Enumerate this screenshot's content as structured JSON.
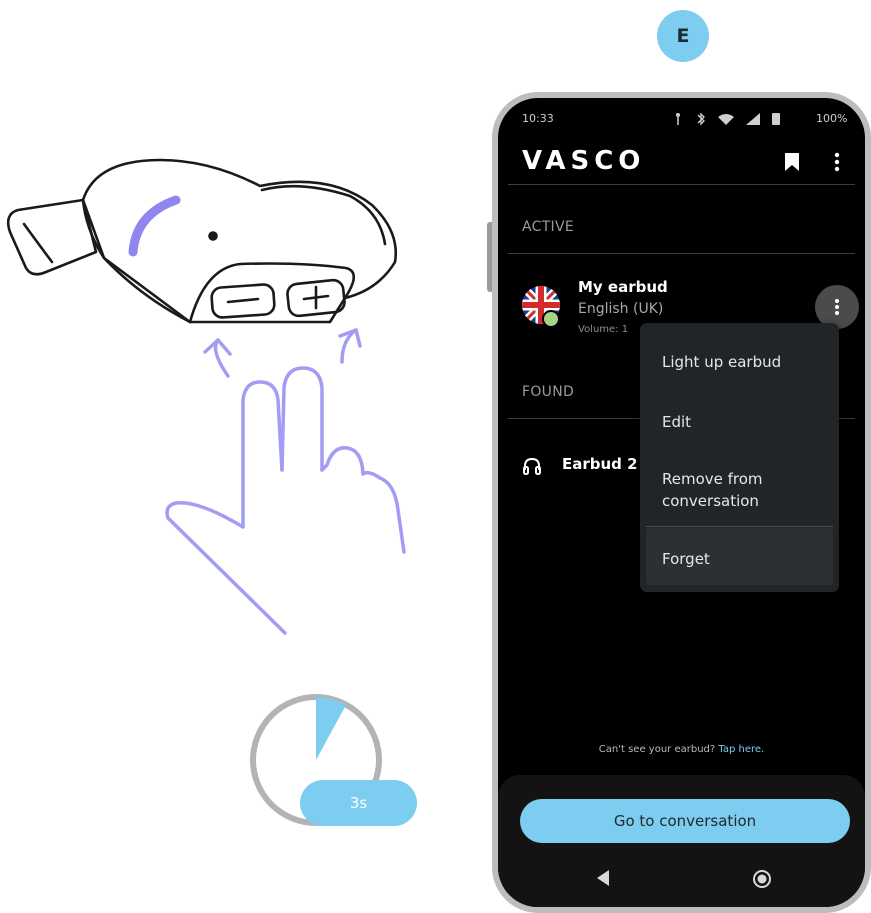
{
  "step_badge": "E",
  "timer_label": "3s",
  "phone": {
    "status_bar": {
      "time": "10:33",
      "battery": "100%"
    },
    "app": {
      "logo": "VASCO",
      "section_active": "ACTIVE",
      "active_device": {
        "name": "My earbud",
        "language": "English (UK)",
        "volume": "Volume: 1"
      },
      "section_found": "FOUND",
      "found_device": {
        "name": "Earbud 2"
      },
      "context_menu": {
        "items": [
          "Light up earbud",
          "Edit",
          "Remove from conversation",
          "Forget"
        ]
      },
      "help_text": "Can't see your earbud?",
      "help_link": "Tap here.",
      "cta_label": "Go to conversation"
    }
  },
  "colors": {
    "accent": "#7ccdf0",
    "illustration_stroke": "#a29cf4",
    "screen_bg": "#000000",
    "menu_bg": "#222527"
  },
  "icons": [
    "bookmark-icon",
    "overflow-menu-icon",
    "headphones-icon",
    "back-triangle-icon",
    "home-circle-icon",
    "uk-flag-icon",
    "timer-icon",
    "earbud-device-illustration",
    "two-finger-hand-illustration"
  ]
}
